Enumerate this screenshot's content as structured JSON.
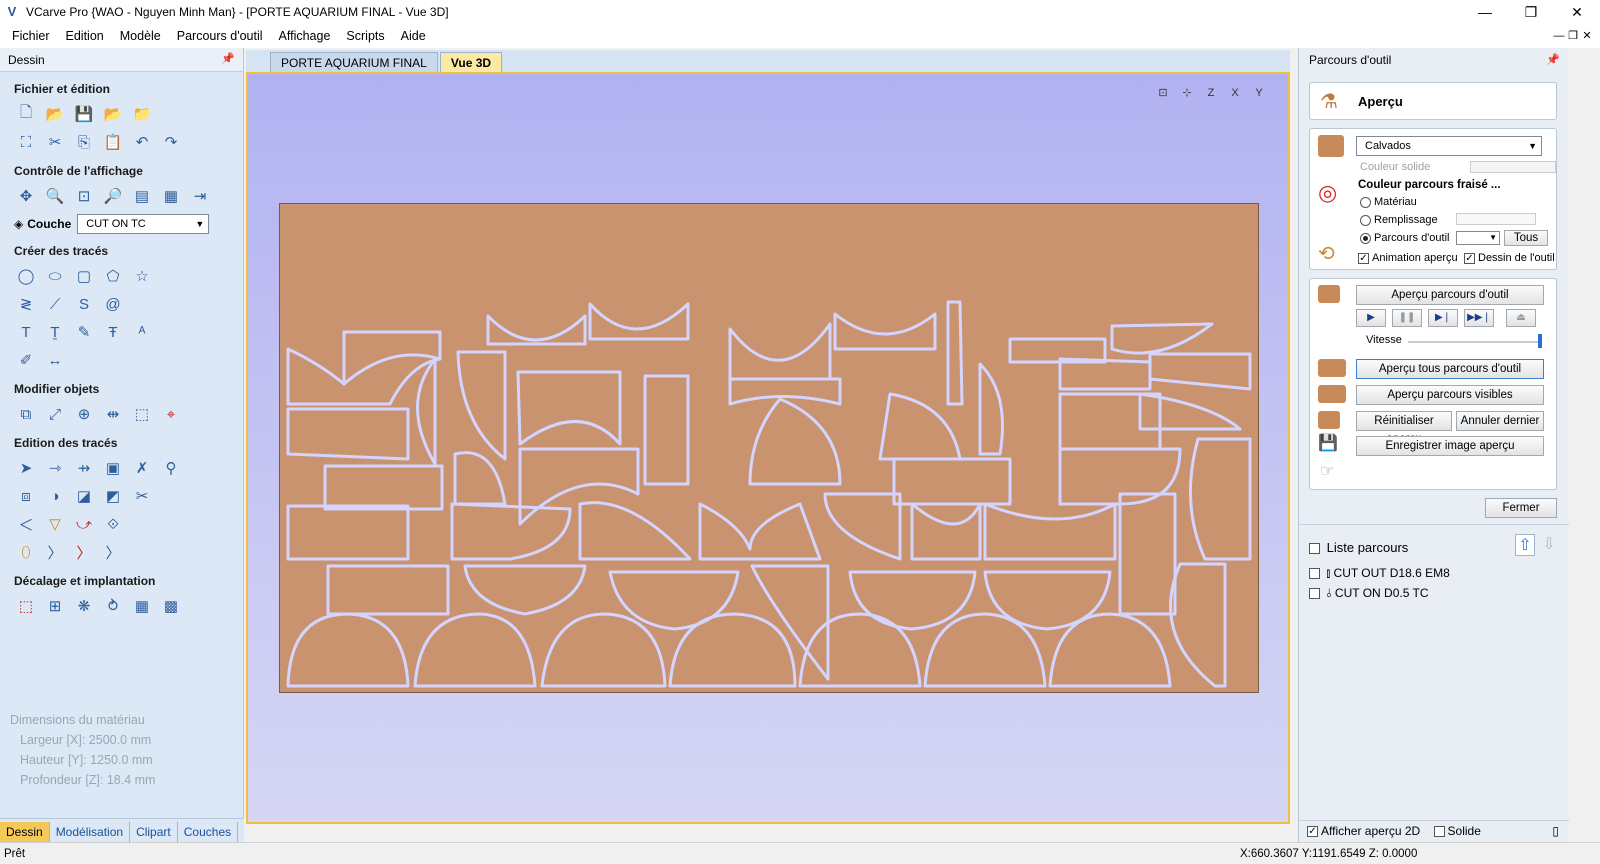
{
  "window": {
    "title": "VCarve Pro {WAO - Nguyen Minh Man} - [PORTE AQUARIUM FINAL - Vue 3D]",
    "controls": [
      "—",
      "❐",
      "✕"
    ]
  },
  "menu": [
    "Fichier",
    "Edition",
    "Modèle",
    "Parcours d'outil",
    "Affichage",
    "Scripts",
    "Aide"
  ],
  "left_panel": {
    "header": "Dessin",
    "sections": {
      "file": "Fichier et édition",
      "view": "Contrôle de l'affichage",
      "create": "Créer des tracés",
      "modify": "Modifier objets",
      "edit": "Edition des tracés",
      "offset": "Décalage et implantation"
    },
    "layer_label": "Couche",
    "layer_value": "CUT ON TC",
    "dimensions": {
      "title": "Dimensions du matériau",
      "width": "Largeur    [X]: 2500.0 mm",
      "height": "Hauteur    [Y]: 1250.0 mm",
      "depth": "Profondeur [Z]: 18.4 mm"
    },
    "tabs": [
      "Dessin",
      "Modélisation",
      "Clipart",
      "Couches"
    ]
  },
  "doc_tabs": [
    "PORTE AQUARIUM FINAL",
    "Vue 3D"
  ],
  "view_icons": [
    "⊡",
    "⊹",
    "Z",
    "X",
    "Y"
  ],
  "right_panel": {
    "header": "Parcours d'outil",
    "apercu_title": "Aperçu",
    "material": "Calvados",
    "solid_color": "Couleur solide",
    "toolpath_color_title": "Couleur parcours fraisé ...",
    "radio_materiau": "Matériau",
    "radio_remplissage": "Remplissage",
    "radio_parcours": "Parcours d'outil",
    "tous": "Tous",
    "animation": "Animation aperçu",
    "dessin_outil": "Dessin de l'outil",
    "btn_apercu_parcours": "Aperçu parcours d'outil",
    "vitesse": "Vitesse",
    "btn_apercu_tous": "Aperçu tous parcours d'outil",
    "btn_apercu_visibles": "Aperçu parcours visibles",
    "btn_reinit": "Réinitialiser aperçu",
    "btn_annuler": "Annuler dernier",
    "btn_enregistrer": "Enregistrer image aperçu",
    "btn_fermer": "Fermer",
    "liste_title": "Liste parcours",
    "toolpaths": [
      "CUT OUT D18.6 EM8",
      "CUT ON D0.5 TC"
    ],
    "show_2d": "Afficher aperçu 2D",
    "solide": "Solide"
  },
  "status": {
    "text": "Prêt",
    "coords": "X:660.3607 Y:1191.6549 Z:  0.0000"
  },
  "colors": {
    "wood": "#c8936e",
    "viewport_top": "#b2b2f2",
    "active_tab": "#fbe9a4",
    "toolpath": "#cfd0ff"
  }
}
